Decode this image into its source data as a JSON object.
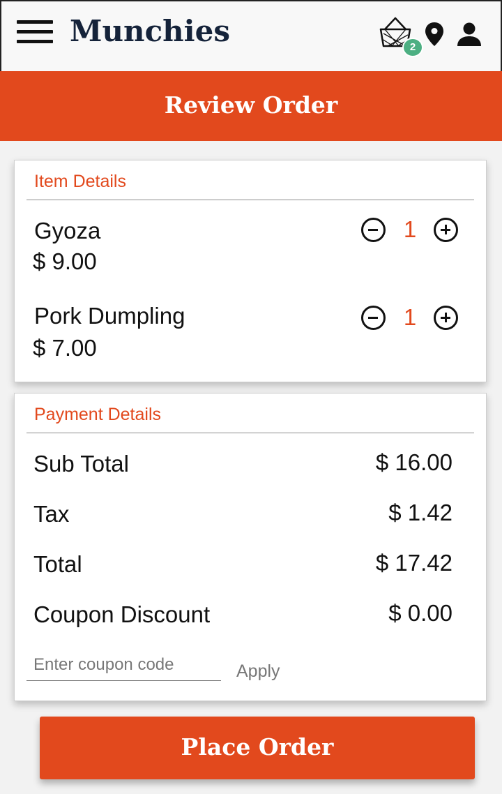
{
  "header": {
    "brand": "Munchies",
    "cart_count": "2"
  },
  "banner": {
    "title": "Review Order"
  },
  "items_card": {
    "title": "Item Details",
    "items": [
      {
        "name": "Gyoza",
        "price": "$ 9.00",
        "quantity": "1"
      },
      {
        "name": "Pork Dumpling",
        "price": "$ 7.00",
        "quantity": "1"
      }
    ]
  },
  "payment_card": {
    "title": "Payment Details",
    "rows": [
      {
        "label": "Sub Total",
        "value": "$ 16.00"
      },
      {
        "label": "Tax",
        "value": "$ 1.42"
      },
      {
        "label": "Total",
        "value": "$ 17.42"
      },
      {
        "label": "Coupon Discount",
        "value": "$ 0.00"
      }
    ],
    "coupon_placeholder": "Enter coupon code",
    "coupon_value": "",
    "apply_label": "Apply"
  },
  "footer": {
    "place_order_label": "Place Order"
  },
  "colors": {
    "accent": "#e2491d",
    "badge": "#4caf82",
    "brand_text": "#15233a"
  },
  "icons": [
    "menu-icon",
    "basket-icon",
    "location-pin-icon",
    "user-icon",
    "minus-circle-icon",
    "plus-circle-icon"
  ]
}
